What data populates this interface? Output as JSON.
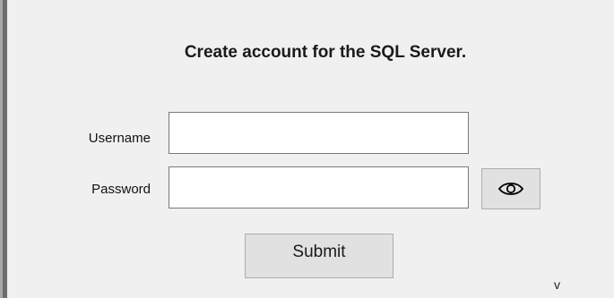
{
  "form": {
    "title": "Create account for the SQL Server.",
    "username_label": "Username",
    "username_value": "",
    "password_label": "Password",
    "password_value": "",
    "show_password_icon": "eye-icon",
    "submit_label": "Submit",
    "footer_mark": "v"
  }
}
